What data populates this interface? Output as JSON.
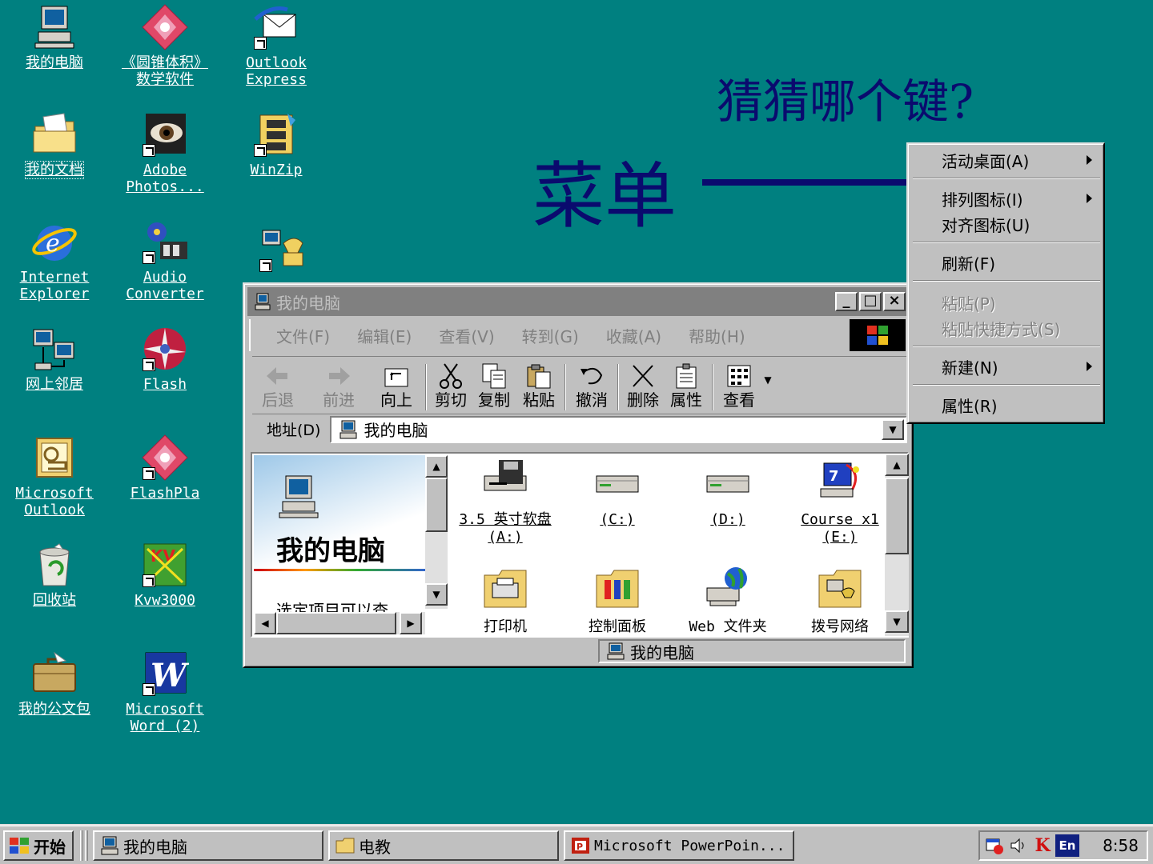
{
  "desktop": {
    "icons": [
      {
        "label": "我的电脑",
        "icon": "my-computer-icon"
      },
      {
        "label": "《圆锥体积》\n数学软件",
        "icon": "cone-software-icon"
      },
      {
        "label": "Outlook\nExpress",
        "icon": "outlook-express-icon"
      },
      {
        "label": "我的文档",
        "icon": "my-documents-icon"
      },
      {
        "label": "Adobe\nPhotos...",
        "icon": "adobe-photoshop-icon"
      },
      {
        "label": "WinZip",
        "icon": "winzip-icon"
      },
      {
        "label": "Internet\nExplorer",
        "icon": "internet-explorer-icon"
      },
      {
        "label": "Audio\nConverter",
        "icon": "audio-converter-icon"
      },
      {
        "label": "",
        "icon": "network-dialer-icon"
      },
      {
        "label": "网上邻居",
        "icon": "network-neighborhood-icon"
      },
      {
        "label": "Flash",
        "icon": "flash-icon"
      },
      {
        "label": "Microsoft\nOutlook",
        "icon": "microsoft-outlook-icon"
      },
      {
        "label": "FlashPla",
        "icon": "flash-player-icon"
      },
      {
        "label": "回收站",
        "icon": "recycle-bin-icon"
      },
      {
        "label": "Kvw3000",
        "icon": "kv3000-antivirus-icon"
      },
      {
        "label": "我的公文包",
        "icon": "briefcase-icon"
      },
      {
        "label": "Microsoft\nWord (2)",
        "icon": "microsoft-word-icon"
      }
    ]
  },
  "slide": {
    "question": "猜猜哪个键?",
    "label": "菜单",
    "arrow_color": "#0a0a6e"
  },
  "window": {
    "title": "我的电脑",
    "menu": [
      "文件(F)",
      "编辑(E)",
      "查看(V)",
      "转到(G)",
      "收藏(A)",
      "帮助(H)"
    ],
    "toolbar": [
      {
        "label": "后退",
        "icon": "back-arrow-icon",
        "enabled": false
      },
      {
        "label": "前进",
        "icon": "forward-arrow-icon",
        "enabled": false
      },
      {
        "label": "向上",
        "icon": "up-folder-icon",
        "enabled": true
      },
      {
        "label": "剪切",
        "icon": "scissors-icon",
        "enabled": true
      },
      {
        "label": "复制",
        "icon": "copy-icon",
        "enabled": true
      },
      {
        "label": "粘贴",
        "icon": "paste-icon",
        "enabled": true
      },
      {
        "label": "撤消",
        "icon": "undo-icon",
        "enabled": true
      },
      {
        "label": "删除",
        "icon": "delete-x-icon",
        "enabled": true
      },
      {
        "label": "属性",
        "icon": "properties-icon",
        "enabled": true
      },
      {
        "label": "查看",
        "icon": "view-icon",
        "enabled": true
      }
    ],
    "address_label": "地址(D)",
    "address_value": "我的电脑",
    "left_pane_title": "我的电脑",
    "left_pane_text": "选定项目可以查",
    "files": [
      {
        "label": "3.5 英寸软盘\n(A:)",
        "icon": "floppy-drive-icon"
      },
      {
        "label": "(C:)",
        "icon": "hard-drive-icon"
      },
      {
        "label": "(D:)",
        "icon": "hard-drive-icon"
      },
      {
        "label": "Course x1\n(E:)",
        "icon": "cd-drive-icon"
      },
      {
        "label": "打印机",
        "icon": "printers-folder-icon"
      },
      {
        "label": "控制面板",
        "icon": "control-panel-icon"
      },
      {
        "label": "Web 文件夹",
        "icon": "web-folders-icon"
      },
      {
        "label": "拨号网络",
        "icon": "dialup-networking-icon"
      }
    ],
    "status_text": "我的电脑"
  },
  "context_menu": {
    "items": [
      {
        "label": "活动桌面(A)",
        "submenu": true,
        "enabled": true
      },
      {
        "label": "排列图标(I)",
        "submenu": true,
        "enabled": true
      },
      {
        "label": "对齐图标(U)",
        "submenu": false,
        "enabled": true
      },
      {
        "label": "刷新(F)",
        "submenu": false,
        "enabled": true
      },
      {
        "label": "粘贴(P)",
        "submenu": false,
        "enabled": false
      },
      {
        "label": "粘贴快捷方式(S)",
        "submenu": false,
        "enabled": false
      },
      {
        "label": "新建(N)",
        "submenu": true,
        "enabled": true
      },
      {
        "label": "属性(R)",
        "submenu": false,
        "enabled": true
      }
    ]
  },
  "taskbar": {
    "start_label": "开始",
    "tasks": [
      {
        "label": "我的电脑",
        "icon": "my-computer-icon"
      },
      {
        "label": "电教",
        "icon": "folder-icon"
      },
      {
        "label": "Microsoft PowerPoin...",
        "icon": "powerpoint-icon"
      }
    ],
    "tray_ime": "En",
    "tray_k": "K",
    "clock": "8:58"
  },
  "colors": {
    "desktop": "#008080",
    "window_face": "#c0c0c0",
    "inactive_title": "#808080"
  }
}
